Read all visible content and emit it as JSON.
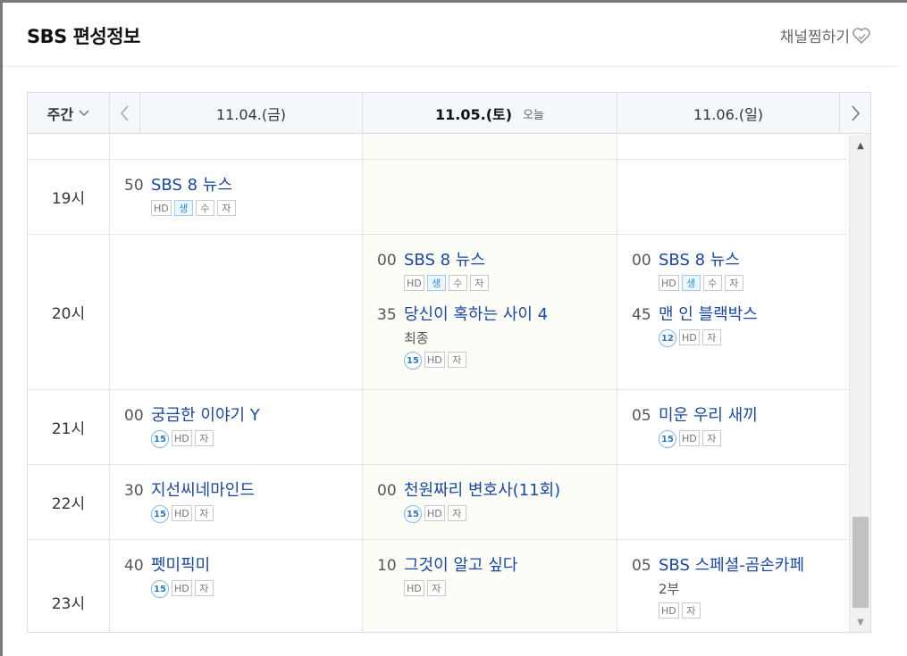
{
  "header": {
    "title": "SBS 편성정보",
    "fav_label": "채널찜하기"
  },
  "thead": {
    "week_label": "주간",
    "days": [
      {
        "date": "11.04.(금)",
        "today": ""
      },
      {
        "date": "11.05.(토)",
        "today": "오늘"
      },
      {
        "date": "11.06.(일)",
        "today": ""
      }
    ]
  },
  "rows": [
    {
      "hour": "19시",
      "d1": [
        {
          "min": "50",
          "name": "SBS 8 뉴스",
          "badges": [
            "HD",
            "생",
            "수",
            "자"
          ]
        }
      ],
      "d2": [],
      "d3": []
    },
    {
      "hour": "20시",
      "d1": [],
      "d2": [
        {
          "min": "00",
          "name": "SBS 8 뉴스",
          "badges": [
            "HD",
            "생",
            "수",
            "자"
          ]
        },
        {
          "min": "35",
          "name": "당신이 혹하는 사이 4",
          "sub": "최종",
          "badges": [
            "15",
            "HD",
            "자"
          ]
        }
      ],
      "d3": [
        {
          "min": "00",
          "name": "SBS 8 뉴스",
          "badges": [
            "HD",
            "생",
            "수",
            "자"
          ]
        },
        {
          "min": "45",
          "name": "맨 인 블랙박스",
          "badges": [
            "12",
            "HD",
            "자"
          ]
        }
      ]
    },
    {
      "hour": "21시",
      "d1": [
        {
          "min": "00",
          "name": "궁금한 이야기 Y",
          "badges": [
            "15",
            "HD",
            "자"
          ]
        }
      ],
      "d2": [],
      "d3": [
        {
          "min": "05",
          "name": "미운 우리 새끼",
          "badges": [
            "15",
            "HD",
            "자"
          ]
        }
      ]
    },
    {
      "hour": "22시",
      "d1": [
        {
          "min": "30",
          "name": "지선씨네마인드",
          "badges": [
            "15",
            "HD",
            "자"
          ]
        }
      ],
      "d2": [
        {
          "min": "00",
          "name": "천원짜리 변호사(11회)",
          "badges": [
            "15",
            "HD",
            "자"
          ]
        }
      ],
      "d3": []
    },
    {
      "hour": "23시",
      "d1": [
        {
          "min": "40",
          "name": "펫미픽미",
          "badges": [
            "15",
            "HD",
            "자"
          ]
        }
      ],
      "d2": [
        {
          "min": "10",
          "name": "그것이 알고 싶다",
          "badges": [
            "HD",
            "자"
          ]
        }
      ],
      "d3": [
        {
          "min": "05",
          "name": "SBS 스페셜-곰손카페",
          "sub": "2부",
          "badges": [
            "HD",
            "자"
          ]
        }
      ]
    }
  ],
  "colors": {
    "program_link": "#1a47a5",
    "live_badge": "#2a8fd6",
    "age_badge": "#2a7ac2"
  }
}
